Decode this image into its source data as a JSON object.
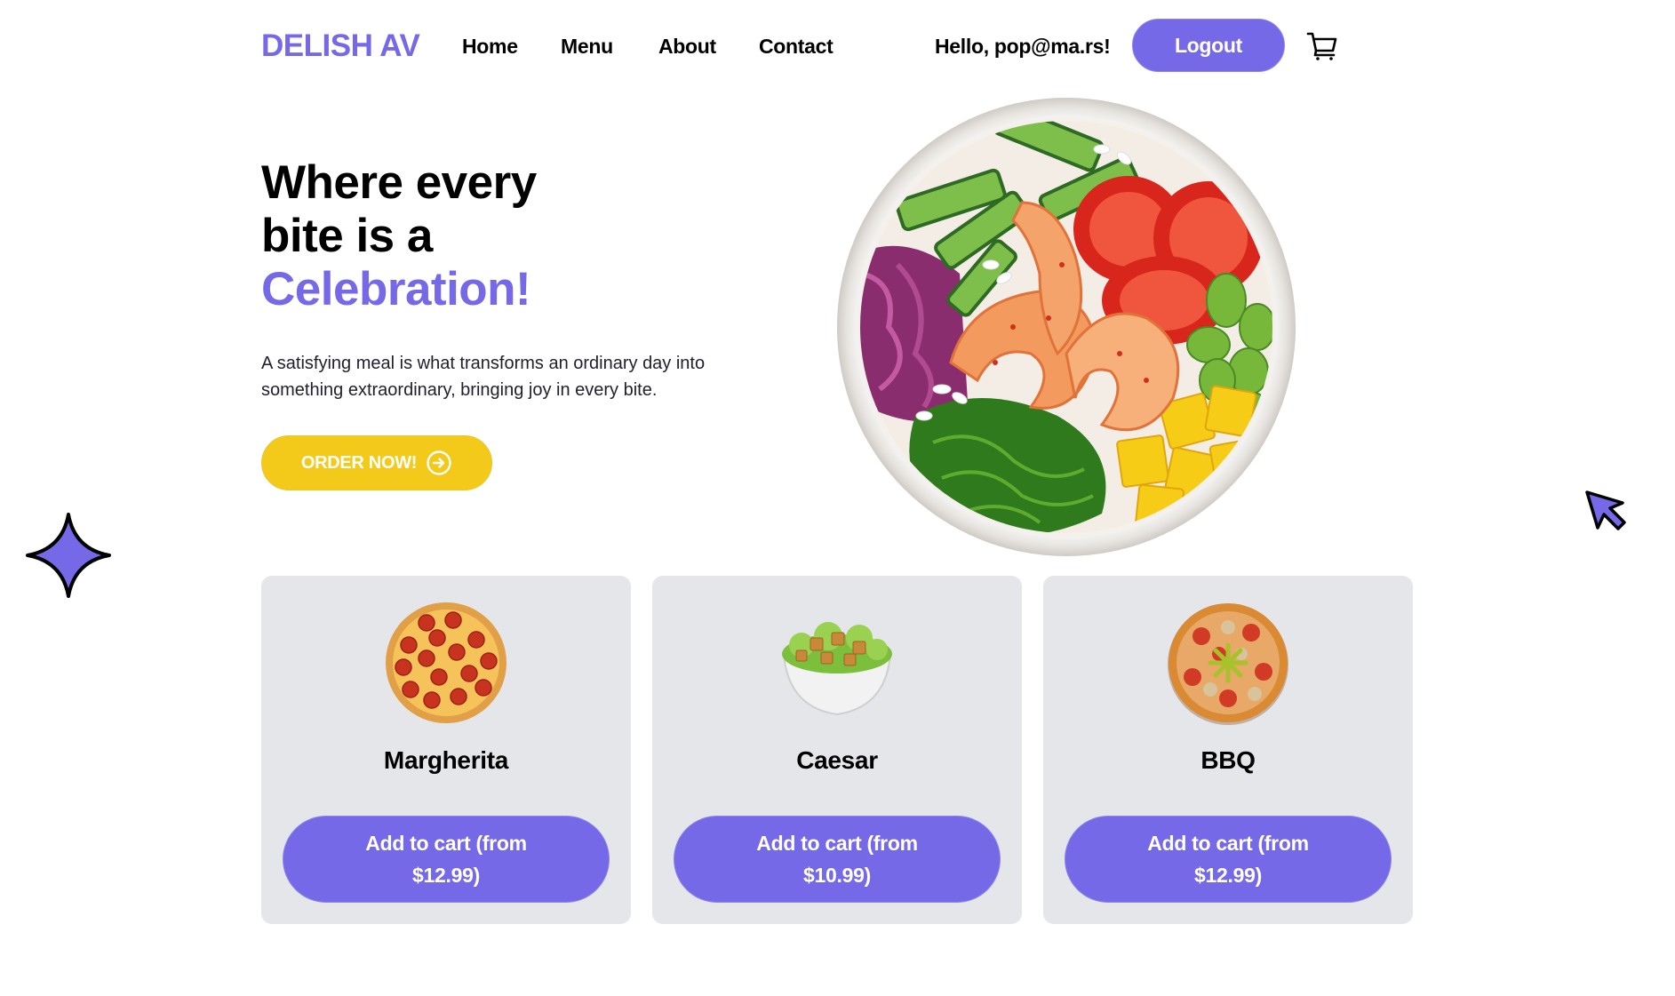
{
  "header": {
    "logo": "DELISH AV",
    "nav": [
      {
        "label": "Home"
      },
      {
        "label": "Menu"
      },
      {
        "label": "About"
      },
      {
        "label": "Contact"
      }
    ],
    "greeting": "Hello, pop@ma.rs!",
    "logout_label": "Logout",
    "cart_icon": "shopping-cart-icon"
  },
  "hero": {
    "title_line1": "Where every",
    "title_line2": "bite is a",
    "title_accent": "Celebration!",
    "description": "A satisfying meal is what transforms an ordinary day into something extraordinary, bringing joy in every bite.",
    "cta_label": "ORDER NOW!",
    "cta_icon": "arrow-right-circle-icon",
    "image": "poke-bowl-image"
  },
  "decor": {
    "left_icon": "sparkle-star-icon",
    "right_icon": "cursor-arrow-icon"
  },
  "products": [
    {
      "name": "Margherita",
      "button_label": "Add to cart (from $12.99)",
      "price": "$12.99",
      "image": "pepperoni-pizza-image"
    },
    {
      "name": "Caesar",
      "button_label": "Add to cart (from $10.99)",
      "price": "$10.99",
      "image": "caesar-salad-image"
    },
    {
      "name": "BBQ",
      "button_label": "Add to cart (from $12.99)",
      "price": "$12.99",
      "image": "bbq-pizza-image"
    }
  ],
  "colors": {
    "accent": "#7569e8",
    "cta_yellow": "#f4ca1a",
    "card_bg": "#e5e6ea",
    "text": "#000000"
  }
}
